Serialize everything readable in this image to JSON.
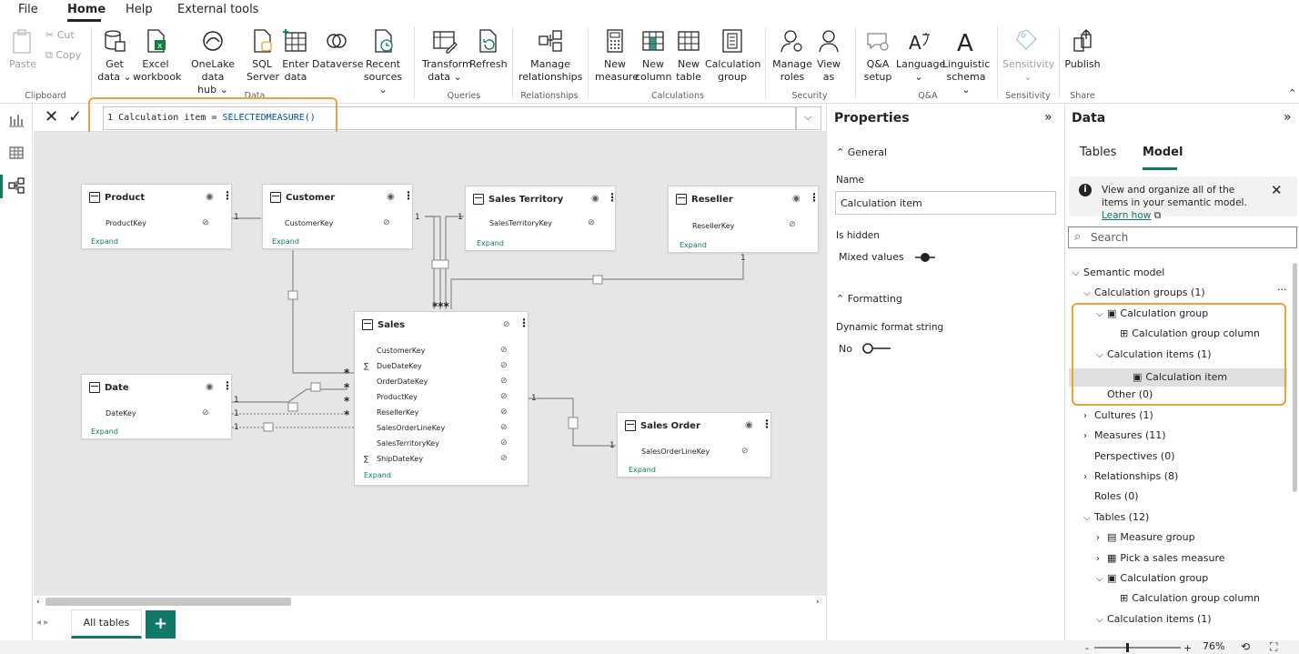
{
  "menu": {
    "file": "File",
    "home": "Home",
    "help": "Help",
    "external_tools": "External tools"
  },
  "ribbon": {
    "paste": "Paste",
    "cut": "Cut",
    "copy": "Copy",
    "get_data_1": "Get",
    "get_data_2": "data ⌄",
    "excel_1": "Excel",
    "excel_2": "workbook",
    "onelake_1": "OneLake data",
    "onelake_2": "hub ⌄",
    "sql_1": "SQL",
    "sql_2": "Server",
    "enter_1": "Enter",
    "enter_2": "data",
    "dataverse": "Dataverse",
    "recent_1": "Recent",
    "recent_2": "sources ⌄",
    "transform_1": "Transform",
    "transform_2": "data ⌄",
    "refresh": "Refresh",
    "manage_rel_1": "Manage",
    "manage_rel_2": "relationships",
    "new_measure_1": "New",
    "new_measure_2": "measure",
    "new_column_1": "New",
    "new_column_2": "column",
    "new_table_1": "New",
    "new_table_2": "table",
    "calc_group_1": "Calculation",
    "calc_group_2": "group",
    "manage_roles_1": "Manage",
    "manage_roles_2": "roles",
    "view_as_1": "View",
    "view_as_2": "as",
    "qa_setup_1": "Q&A",
    "qa_setup_2": "setup",
    "language_1": "Language",
    "language_2": "⌄",
    "linguistic_1": "Linguistic",
    "linguistic_2": "schema ⌄",
    "sensitivity_1": "Sensitivity",
    "sensitivity_2": "⌄",
    "publish": "Publish",
    "groups": {
      "clipboard": "Clipboard",
      "data": "Data",
      "queries": "Queries",
      "relationships": "Relationships",
      "calculations": "Calculations",
      "security": "Security",
      "qa": "Q&A",
      "sensitivity": "Sensitivity",
      "share": "Share"
    }
  },
  "formula": {
    "line": "1",
    "text": "Calculation item = ",
    "func": "SELECTEDMEASURE()"
  },
  "tables": {
    "product": {
      "name": "Product",
      "fields": [
        "ProductKey"
      ],
      "expand": "Expand"
    },
    "customer": {
      "name": "Customer",
      "fields": [
        "CustomerKey"
      ],
      "expand": "Expand"
    },
    "sales_territory": {
      "name": "Sales Territory",
      "fields": [
        "SalesTerritoryKey"
      ],
      "expand": "Expand"
    },
    "reseller": {
      "name": "Reseller",
      "fields": [
        "ResellerKey"
      ],
      "expand": "Expand"
    },
    "sales": {
      "name": "Sales",
      "fields": [
        "CustomerKey",
        "DueDateKey",
        "OrderDateKey",
        "ProductKey",
        "ResellerKey",
        "SalesOrderLineKey",
        "SalesTerritoryKey",
        "ShipDateKey"
      ],
      "expand": "Expand"
    },
    "date": {
      "name": "Date",
      "fields": [
        "DateKey"
      ],
      "expand": "Expand"
    },
    "sales_order": {
      "name": "Sales Order",
      "fields": [
        "SalesOrderLineKey"
      ],
      "expand": "Expand"
    }
  },
  "cardinality": {
    "one": "1",
    "many": "*",
    "many3": "***"
  },
  "bottom_tabs": {
    "all_tables": "All tables",
    "add": "+"
  },
  "properties": {
    "title": "Properties",
    "general": "General",
    "name_label": "Name",
    "name_value": "Calculation item",
    "is_hidden_label": "Is hidden",
    "is_hidden_value": "Mixed values",
    "formatting": "Formatting",
    "dynamic_label": "Dynamic format string",
    "dynamic_value": "No"
  },
  "data_pane": {
    "title": "Data",
    "tab_tables": "Tables",
    "tab_model": "Model",
    "info_text": "View and organize all of the items in your semantic model.",
    "info_link": "Learn how",
    "search_placeholder": "Search",
    "tree": [
      {
        "label": "Semantic model",
        "indent": 0,
        "chev": "⌵"
      },
      {
        "label": "Calculation groups (1)",
        "indent": 1,
        "chev": "⌵"
      },
      {
        "label": "Calculation group",
        "indent": 2,
        "chev": "⌵",
        "icon": "calc"
      },
      {
        "label": "Calculation group column",
        "indent": 3,
        "chev": "",
        "icon": "col"
      },
      {
        "label": "Calculation items (1)",
        "indent": 2,
        "chev": "⌵"
      },
      {
        "label": "Calculation item",
        "indent": 4,
        "chev": "",
        "icon": "calc",
        "selected": true
      },
      {
        "label": "Other (0)",
        "indent": 2,
        "chev": ""
      },
      {
        "label": "Cultures (1)",
        "indent": 1,
        "chev": "›"
      },
      {
        "label": "Measures (11)",
        "indent": 1,
        "chev": "›"
      },
      {
        "label": "Perspectives (0)",
        "indent": 1,
        "chev": ""
      },
      {
        "label": "Relationships (8)",
        "indent": 1,
        "chev": "›"
      },
      {
        "label": "Roles (0)",
        "indent": 1,
        "chev": ""
      },
      {
        "label": "Tables (12)",
        "indent": 1,
        "chev": "⌵"
      },
      {
        "label": "Measure group",
        "indent": 2,
        "chev": "›",
        "icon": "tbl"
      },
      {
        "label": "Pick a sales measure",
        "indent": 2,
        "chev": "›",
        "icon": "tbl2"
      },
      {
        "label": "Calculation group",
        "indent": 2,
        "chev": "⌵",
        "icon": "calc"
      },
      {
        "label": "Calculation group column",
        "indent": 3,
        "chev": "",
        "icon": "col"
      },
      {
        "label": "Calculation items (1)",
        "indent": 2,
        "chev": "⌵"
      }
    ]
  },
  "status": {
    "zoom": "76%"
  },
  "colors": {
    "accent": "#117865",
    "highlight": "#e8a33d"
  }
}
